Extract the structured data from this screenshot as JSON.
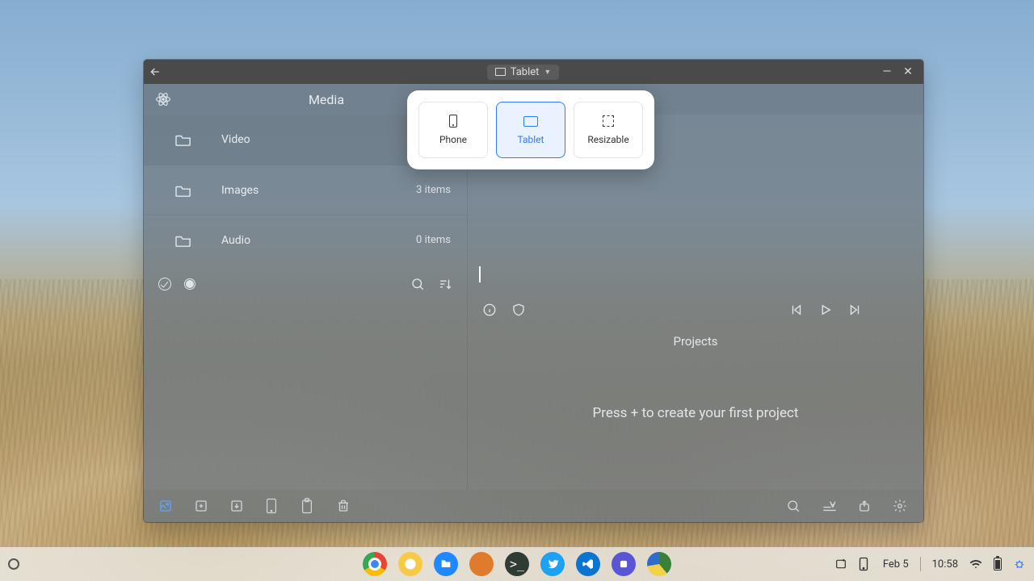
{
  "titlebar": {
    "title_label": "Tablet"
  },
  "app": {
    "header_title": "Media"
  },
  "folders": [
    {
      "name": "Video",
      "count": ""
    },
    {
      "name": "Images",
      "count": "3 items"
    },
    {
      "name": "Audio",
      "count": "0 items"
    }
  ],
  "projects": {
    "heading": "Projects",
    "hint": "Press + to create your first project"
  },
  "popover": {
    "options": [
      {
        "label": "Phone"
      },
      {
        "label": "Tablet"
      },
      {
        "label": "Resizable"
      }
    ]
  },
  "shelf": {
    "date": "Feb 5",
    "time": "10:58"
  }
}
